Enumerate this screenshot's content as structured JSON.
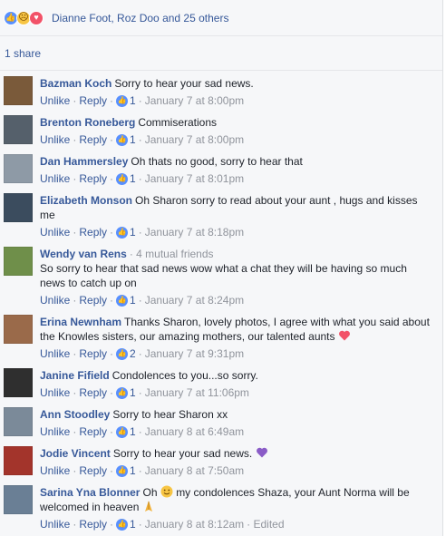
{
  "reactions": {
    "names": "Dianne Foot, Roz Doo and 25 others"
  },
  "shares": "1 share",
  "comments": [
    {
      "author": "Bazman Koch",
      "mutual": "",
      "text": "Sorry to hear your sad news.",
      "text2": "",
      "likes": "1",
      "time": "January 7 at 8:00pm",
      "edited": "",
      "avatar_color": "#7a5a3a"
    },
    {
      "author": "Brenton Roneberg",
      "mutual": "",
      "text": "Commiserations",
      "text2": "",
      "likes": "1",
      "time": "January 7 at 8:00pm",
      "edited": "",
      "avatar_color": "#55606b"
    },
    {
      "author": "Dan Hammersley",
      "mutual": "",
      "text": "Oh thats no good, sorry to hear that",
      "text2": "",
      "likes": "1",
      "time": "January 7 at 8:01pm",
      "edited": "",
      "avatar_color": "#8e9aa6"
    },
    {
      "author": "Elizabeth Monson",
      "mutual": "",
      "text": "Oh Sharon sorry to read about your aunt , hugs and kisses me",
      "text2": "",
      "likes": "1",
      "time": "January 7 at 8:18pm",
      "edited": "",
      "avatar_color": "#3b4c5e"
    },
    {
      "author": "Wendy van Rens",
      "mutual": "· 4 mutual friends",
      "text": "So sorry to hear that sad news wow what a chat they will be having so much news to catch up on",
      "text2": "",
      "likes": "1",
      "time": "January 7 at 8:24pm",
      "edited": "",
      "avatar_color": "#6f8f4a"
    },
    {
      "author": "Erina Newnham",
      "mutual": "",
      "text": "Thanks Sharon, lovely photos, I agree with what you said about the Knowles sisters, our amazing mothers, our talented aunts",
      "text2": "",
      "likes": "2",
      "time": "January 7 at 9:31pm",
      "edited": "",
      "avatar_color": "#9a6a4a"
    },
    {
      "author": "Janine Fifield",
      "mutual": "",
      "text": "Condolences to you...so sorry.",
      "text2": "",
      "likes": "1",
      "time": "January 7 at 11:06pm",
      "edited": "",
      "avatar_color": "#2f2f2f"
    },
    {
      "author": "Ann Stoodley",
      "mutual": "",
      "text": "Sorry to hear Sharon xx",
      "text2": "",
      "likes": "1",
      "time": "January 8 at 6:49am",
      "edited": "",
      "avatar_color": "#7b8a99"
    },
    {
      "author": "Jodie Vincent",
      "mutual": "",
      "text": "Sorry to hear your sad news.",
      "text2": "",
      "likes": "1",
      "time": "January 8 at 7:50am",
      "edited": "",
      "avatar_color": "#a3342b"
    },
    {
      "author": "Sarina Yna Blonner",
      "mutual": "",
      "text": "Oh",
      "text2": "my condolences Shaza, your Aunt Norma will be welcomed in heaven",
      "likes": "1",
      "time": "January 8 at 8:12am",
      "edited": "· Edited",
      "avatar_color": "#6a7f95"
    }
  ],
  "labels": {
    "unlike": "Unlike",
    "reply": "Reply"
  },
  "colors": {
    "link": "#365899",
    "meta": "#90949c",
    "like": "#5890ff",
    "heart": "#f25268",
    "purple_heart": "#8a5cc7"
  },
  "icons": {
    "like": "like-icon",
    "sad": "sad-face-icon",
    "love": "heart-icon"
  }
}
